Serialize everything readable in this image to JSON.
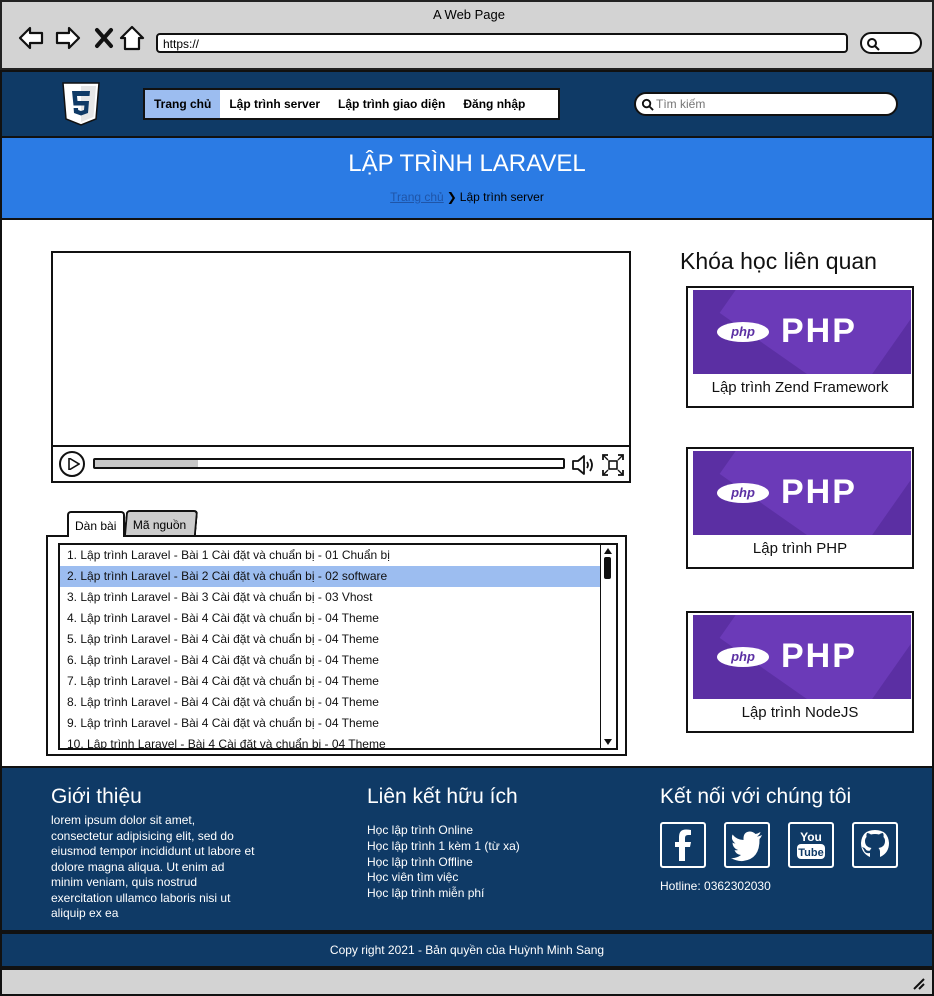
{
  "browser": {
    "title": "A Web Page",
    "url": "https://"
  },
  "header": {
    "menu": [
      {
        "label": "Trang chủ",
        "active": true
      },
      {
        "label": "Lập trình server",
        "active": false
      },
      {
        "label": "Lập trình giao diện",
        "active": false
      },
      {
        "label": "Đăng nhập",
        "active": false
      }
    ],
    "search_placeholder": "Tìm kiếm"
  },
  "banner": {
    "title": "LẬP TRÌNH LARAVEL",
    "breadcrumb_home": "Trang chủ",
    "breadcrumb_current": "Lập trình server"
  },
  "video": {
    "progress_fraction": 0.22
  },
  "tabs": {
    "outline": "Dàn bài",
    "source": "Mã nguồn"
  },
  "lessons": [
    "1. Lập trình Laravel - Bài 1 Cài đặt và chuẩn bị - 01 Chuẩn bị",
    "2. Lập trình Laravel - Bài 2 Cài đặt và chuẩn bị - 02 software",
    "3. Lập trình Laravel - Bài 3 Cài đặt và chuẩn bị - 03 Vhost",
    "4. Lập trình Laravel - Bài 4 Cài đặt và chuẩn bị - 04 Theme",
    "5. Lập trình Laravel - Bài 4 Cài đặt và chuẩn bị - 04 Theme",
    "6. Lập trình Laravel - Bài 4 Cài đặt và chuẩn bị - 04 Theme",
    "7. Lập trình Laravel - Bài 4 Cài đặt và chuẩn bị - 04 Theme",
    "8. Lập trình Laravel - Bài 4 Cài đặt và chuẩn bị - 04 Theme",
    "9. Lập trình Laravel - Bài 4 Cài đặt và chuẩn bị - 04 Theme",
    "10. Lập trình Laravel - Bài 4 Cài đặt và chuẩn bị - 04 Theme"
  ],
  "selected_lesson_index": 1,
  "related": {
    "title": "Khóa học liên quan",
    "logo_small": "php",
    "logo_big": "PHP",
    "courses": [
      "Lập trình Zend Framework",
      "Lập trình PHP",
      "Lập trình NodeJS"
    ]
  },
  "footer": {
    "about_title": "Giới thiệu",
    "about_text": "lorem ipsum dolor sit amet, consectetur adipisicing elit, sed do eiusmod tempor incididunt ut labore et dolore magna aliqua. Ut enim ad minim veniam, quis nostrud exercitation ullamco laboris nisi ut aliquip ex ea",
    "links_title": "Liên kết hữu ích",
    "links": [
      "Học lập trình Online",
      "Học lập trình 1 kèm 1 (từ xa)",
      "Học lập trình Offline",
      "Học viên tìm việc",
      "Học lập trình miễn phí"
    ],
    "connect_title": "Kết nối với chúng tôi",
    "social": [
      "facebook-icon",
      "twitter-icon",
      "youtube-icon",
      "github-icon"
    ],
    "youtube_you": "You",
    "youtube_tube": "Tube",
    "hotline": "Hotline: 0362302030",
    "copyright": "Copy right 2021 - Bản quyền của Huỳnh Minh Sang"
  },
  "colors": {
    "header_bg": "#0f3a66",
    "banner_bg": "#2b7be4",
    "highlight": "#9cbdf0",
    "php_purple": "#5b2fa3"
  }
}
